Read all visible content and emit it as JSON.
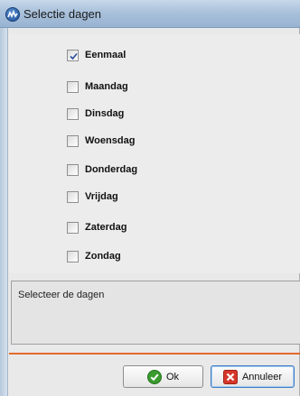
{
  "window": {
    "title": "Selectie dagen",
    "icon": "app-logo-icon"
  },
  "days": [
    {
      "label": "Eenmaal",
      "checked": true
    },
    {
      "label": "Maandag",
      "checked": false
    },
    {
      "label": "Dinsdag",
      "checked": false
    },
    {
      "label": "Woensdag",
      "checked": false
    },
    {
      "label": "Donderdag",
      "checked": false
    },
    {
      "label": "Vrijdag",
      "checked": false
    },
    {
      "label": "Zaterdag",
      "checked": false
    },
    {
      "label": "Zondag",
      "checked": false
    }
  ],
  "info": {
    "text": "Selecteer de dagen"
  },
  "buttons": {
    "ok_label": "Ok",
    "ok_icon": "check-circle-icon",
    "cancel_label": "Annuleer",
    "cancel_icon": "red-x-icon"
  },
  "colors": {
    "separator": "#e46a2b",
    "ok_icon": "#3a9b2f",
    "cancel_icon": "#d6372a"
  }
}
